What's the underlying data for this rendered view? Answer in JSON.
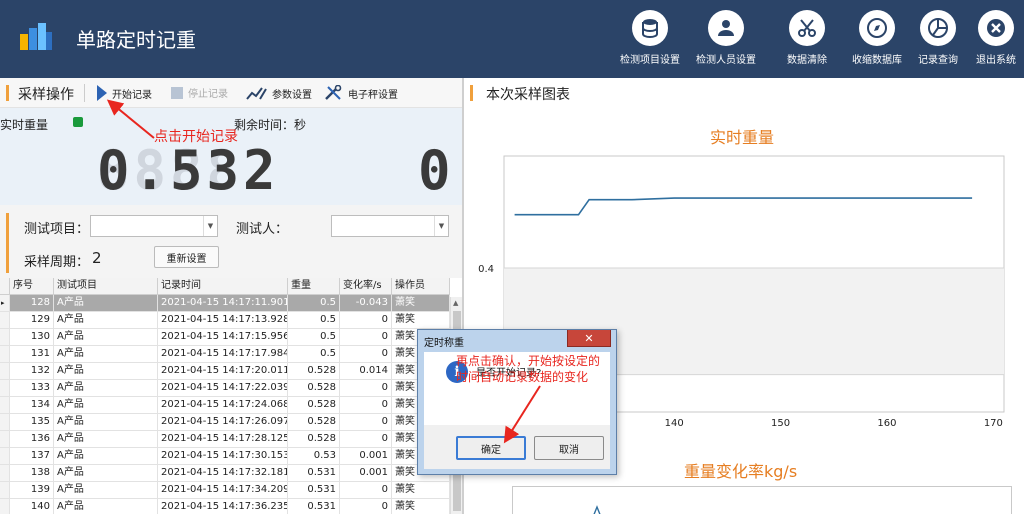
{
  "app": {
    "title": "单路定时记重"
  },
  "header_buttons": [
    {
      "label": "检测项目设置",
      "icon": "database-icon"
    },
    {
      "label": "检测人员设置",
      "icon": "user-icon"
    },
    {
      "label": "数据清除",
      "icon": "scissors-icon"
    },
    {
      "label": "收缩数据库",
      "icon": "compass-icon"
    },
    {
      "label": "记录查询",
      "icon": "pie-chart-icon"
    },
    {
      "label": "退出系统",
      "icon": "close-icon"
    }
  ],
  "left_section": {
    "title": "采样操作"
  },
  "toolbar": {
    "start": "开始记录",
    "stop": "停止记录",
    "params": "参数设置",
    "scale": "电子秤设置"
  },
  "realtime": {
    "weight_label": "实时重量",
    "remaining_label": "剩余时间：秒",
    "weight_value": "0.532",
    "remaining_value": "0",
    "status_color": "#1a9a3c"
  },
  "form": {
    "item_label": "测试项目：",
    "item_value": "",
    "person_label": "测试人：",
    "person_value": "",
    "period_label": "采样周期：",
    "period_value": "2",
    "reset_button": "重新设置"
  },
  "table": {
    "columns": [
      "序号",
      "测试项目",
      "记录时间",
      "重量",
      "变化率/s",
      "操作员"
    ],
    "rows": [
      [
        "128",
        "A产品",
        "2021-04-15 14:17:11.901",
        "0.5",
        "-0.043",
        "萧笑"
      ],
      [
        "129",
        "A产品",
        "2021-04-15 14:17:13.928",
        "0.5",
        "0",
        "萧笑"
      ],
      [
        "130",
        "A产品",
        "2021-04-15 14:17:15.956",
        "0.5",
        "0",
        "萧笑"
      ],
      [
        "131",
        "A产品",
        "2021-04-15 14:17:17.984",
        "0.5",
        "0",
        "萧笑"
      ],
      [
        "132",
        "A产品",
        "2021-04-15 14:17:20.011",
        "0.528",
        "0.014",
        "萧笑"
      ],
      [
        "133",
        "A产品",
        "2021-04-15 14:17:22.039",
        "0.528",
        "0",
        "萧笑"
      ],
      [
        "134",
        "A产品",
        "2021-04-15 14:17:24.068",
        "0.528",
        "0",
        "萧笑"
      ],
      [
        "135",
        "A产品",
        "2021-04-15 14:17:26.097",
        "0.528",
        "0",
        "萧笑"
      ],
      [
        "136",
        "A产品",
        "2021-04-15 14:17:28.125",
        "0.528",
        "0",
        "萧笑"
      ],
      [
        "137",
        "A产品",
        "2021-04-15 14:17:30.153",
        "0.53",
        "0.001",
        "萧笑"
      ],
      [
        "138",
        "A产品",
        "2021-04-15 14:17:32.181",
        "0.531",
        "0.001",
        "萧笑"
      ],
      [
        "139",
        "A产品",
        "2021-04-15 14:17:34.209",
        "0.531",
        "0",
        "萧笑"
      ],
      [
        "140",
        "A产品",
        "2021-04-15 14:17:36.235",
        "0.531",
        "0",
        "萧笑"
      ]
    ],
    "selected_index": 0
  },
  "right_section": {
    "title": "本次采样图表"
  },
  "chart_data": [
    {
      "type": "line",
      "title": "实时重量",
      "xlabel": "",
      "ylabel": "",
      "x": [
        125,
        128,
        130,
        131,
        132,
        133,
        134,
        136,
        140,
        145,
        150,
        155,
        160,
        165,
        168
      ],
      "y": [
        0.5,
        0.5,
        0.5,
        0.5,
        0.528,
        0.528,
        0.528,
        0.528,
        0.531,
        0.531,
        0.531,
        0.531,
        0.531,
        0.531,
        0.531
      ],
      "yticks": [
        "0.4",
        "0.2"
      ],
      "xticks": [
        "140",
        "150",
        "160",
        "170"
      ],
      "xlim": [
        124,
        171
      ],
      "ylim": [
        0.13,
        0.61
      ],
      "color": "#2f6f9f"
    },
    {
      "type": "line",
      "title": "重量变化率kg/s"
    }
  ],
  "dialog": {
    "title": "定时称重",
    "close": "✕",
    "message": "是否开始记录?",
    "ok": "确定",
    "cancel": "取消"
  },
  "annotations": {
    "start_hint": "点击开始记录",
    "confirm_hint_1": "再点击确认，开始按设定的",
    "confirm_hint_2": "时间自动记录数据的变化"
  }
}
